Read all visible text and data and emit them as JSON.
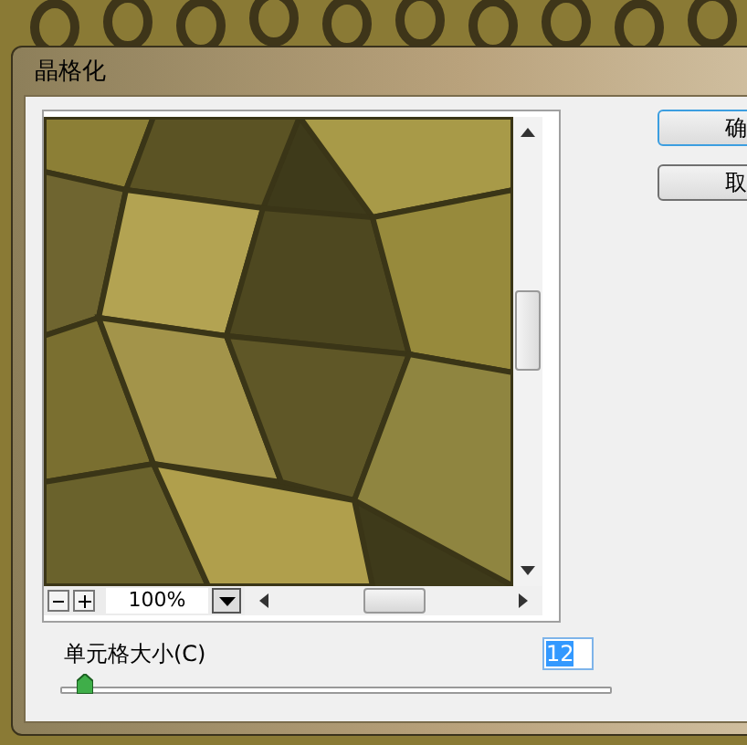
{
  "window": {
    "title": "晶格化"
  },
  "preview": {
    "kind": "picture",
    "zoom": "100%"
  },
  "buttons": [
    {
      "label": "确",
      "default": true
    },
    {
      "label": "取",
      "default": false
    }
  ],
  "cell_size": {
    "label": "单元格大小(C)",
    "value": "12",
    "level": 0.03
  }
}
